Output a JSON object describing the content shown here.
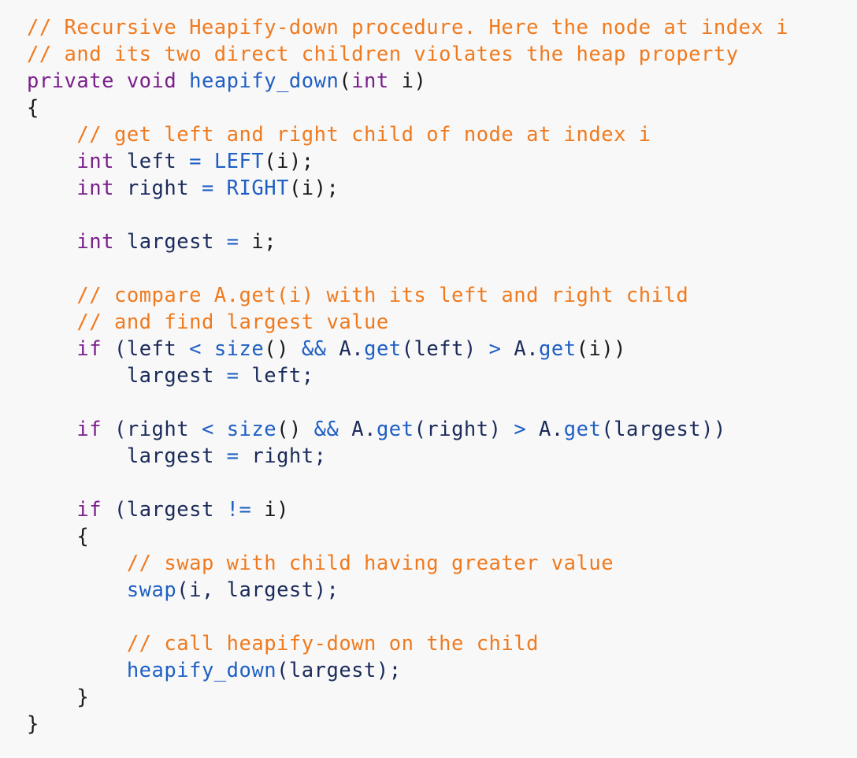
{
  "colors": {
    "background": "#f8f8f8",
    "comment": "#f07a1e",
    "keyword": "#7a1f8c",
    "function": "#1f5fc4",
    "plain": "#1a1a1a",
    "identifier": "#1a2a5a"
  },
  "code": {
    "lines": [
      [
        {
          "t": "comment",
          "v": "// Recursive Heapify-down procedure. Here the node at index i"
        }
      ],
      [
        {
          "t": "comment",
          "v": "// and its two direct children violates the heap property"
        }
      ],
      [
        {
          "t": "keyword",
          "v": "private"
        },
        {
          "t": "plain",
          "v": " "
        },
        {
          "t": "keyword",
          "v": "void"
        },
        {
          "t": "plain",
          "v": " "
        },
        {
          "t": "func",
          "v": "heapify_down"
        },
        {
          "t": "plain",
          "v": "("
        },
        {
          "t": "keyword",
          "v": "int"
        },
        {
          "t": "plain",
          "v": " i)"
        }
      ],
      [
        {
          "t": "plain",
          "v": "{"
        }
      ],
      [
        {
          "t": "plain",
          "v": "    "
        },
        {
          "t": "comment",
          "v": "// get left and right child of node at index i"
        }
      ],
      [
        {
          "t": "plain",
          "v": "    "
        },
        {
          "t": "keyword",
          "v": "int"
        },
        {
          "t": "ident",
          "v": " left "
        },
        {
          "t": "op",
          "v": "="
        },
        {
          "t": "plain",
          "v": " "
        },
        {
          "t": "func",
          "v": "LEFT"
        },
        {
          "t": "plain",
          "v": "(i);"
        }
      ],
      [
        {
          "t": "plain",
          "v": "    "
        },
        {
          "t": "keyword",
          "v": "int"
        },
        {
          "t": "ident",
          "v": " right "
        },
        {
          "t": "op",
          "v": "="
        },
        {
          "t": "plain",
          "v": " "
        },
        {
          "t": "func",
          "v": "RIGHT"
        },
        {
          "t": "plain",
          "v": "(i);"
        }
      ],
      [
        {
          "t": "plain",
          "v": ""
        }
      ],
      [
        {
          "t": "plain",
          "v": "    "
        },
        {
          "t": "keyword",
          "v": "int"
        },
        {
          "t": "ident",
          "v": " largest "
        },
        {
          "t": "op",
          "v": "="
        },
        {
          "t": "plain",
          "v": " i;"
        }
      ],
      [
        {
          "t": "plain",
          "v": ""
        }
      ],
      [
        {
          "t": "plain",
          "v": "    "
        },
        {
          "t": "comment",
          "v": "// compare A.get(i) with its left and right child"
        }
      ],
      [
        {
          "t": "plain",
          "v": "    "
        },
        {
          "t": "comment",
          "v": "// and find largest value"
        }
      ],
      [
        {
          "t": "plain",
          "v": "    "
        },
        {
          "t": "keyword",
          "v": "if"
        },
        {
          "t": "ident",
          "v": " (left "
        },
        {
          "t": "op",
          "v": "<"
        },
        {
          "t": "plain",
          "v": " "
        },
        {
          "t": "func",
          "v": "size"
        },
        {
          "t": "plain",
          "v": "() "
        },
        {
          "t": "op",
          "v": "&&"
        },
        {
          "t": "ident",
          "v": " A."
        },
        {
          "t": "func",
          "v": "get"
        },
        {
          "t": "ident",
          "v": "(left) "
        },
        {
          "t": "op",
          "v": ">"
        },
        {
          "t": "ident",
          "v": " A."
        },
        {
          "t": "func",
          "v": "get"
        },
        {
          "t": "plain",
          "v": "(i))"
        }
      ],
      [
        {
          "t": "plain",
          "v": "        "
        },
        {
          "t": "ident",
          "v": "largest "
        },
        {
          "t": "op",
          "v": "="
        },
        {
          "t": "ident",
          "v": " left;"
        }
      ],
      [
        {
          "t": "plain",
          "v": ""
        }
      ],
      [
        {
          "t": "plain",
          "v": "    "
        },
        {
          "t": "keyword",
          "v": "if"
        },
        {
          "t": "ident",
          "v": " (right "
        },
        {
          "t": "op",
          "v": "<"
        },
        {
          "t": "plain",
          "v": " "
        },
        {
          "t": "func",
          "v": "size"
        },
        {
          "t": "plain",
          "v": "() "
        },
        {
          "t": "op",
          "v": "&&"
        },
        {
          "t": "ident",
          "v": " A."
        },
        {
          "t": "func",
          "v": "get"
        },
        {
          "t": "ident",
          "v": "(right) "
        },
        {
          "t": "op",
          "v": ">"
        },
        {
          "t": "ident",
          "v": " A."
        },
        {
          "t": "func",
          "v": "get"
        },
        {
          "t": "ident",
          "v": "(largest))"
        }
      ],
      [
        {
          "t": "plain",
          "v": "        "
        },
        {
          "t": "ident",
          "v": "largest "
        },
        {
          "t": "op",
          "v": "="
        },
        {
          "t": "ident",
          "v": " right;"
        }
      ],
      [
        {
          "t": "plain",
          "v": ""
        }
      ],
      [
        {
          "t": "plain",
          "v": "    "
        },
        {
          "t": "keyword",
          "v": "if"
        },
        {
          "t": "ident",
          "v": " (largest "
        },
        {
          "t": "op",
          "v": "!="
        },
        {
          "t": "plain",
          "v": " i)"
        }
      ],
      [
        {
          "t": "plain",
          "v": "    {"
        }
      ],
      [
        {
          "t": "plain",
          "v": "        "
        },
        {
          "t": "comment",
          "v": "// swap with child having greater value"
        }
      ],
      [
        {
          "t": "plain",
          "v": "        "
        },
        {
          "t": "func",
          "v": "swap"
        },
        {
          "t": "ident",
          "v": "(i, largest);"
        }
      ],
      [
        {
          "t": "plain",
          "v": ""
        }
      ],
      [
        {
          "t": "plain",
          "v": "        "
        },
        {
          "t": "comment",
          "v": "// call heapify-down on the child"
        }
      ],
      [
        {
          "t": "plain",
          "v": "        "
        },
        {
          "t": "func",
          "v": "heapify_down"
        },
        {
          "t": "ident",
          "v": "(largest);"
        }
      ],
      [
        {
          "t": "plain",
          "v": "    }"
        }
      ],
      [
        {
          "t": "plain",
          "v": "}"
        }
      ]
    ]
  }
}
